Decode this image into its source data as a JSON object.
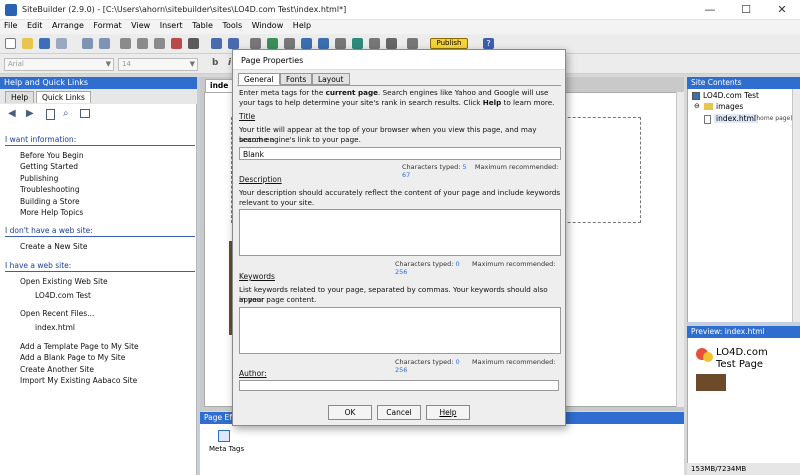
{
  "window": {
    "title": "SiteBuilder (2.9.0) - [C:\\Users\\ahorn\\sitebuilder\\sites\\LO4D.com Test\\index.html*]",
    "minimize": "—",
    "maximize": "☐",
    "close": "✕"
  },
  "menu": [
    "File",
    "Edit",
    "Arrange",
    "Format",
    "View",
    "Insert",
    "Table",
    "Tools",
    "Window",
    "Help"
  ],
  "toolbar": {
    "publish_label": "Publish",
    "help_label": "?"
  },
  "fontbar": {
    "font": "Arial",
    "size": "14",
    "bold": "b",
    "italic": "i"
  },
  "left_panel": {
    "header": "Help and Quick Links",
    "tabs": [
      "Help",
      "Quick Links"
    ],
    "active_tab": "Quick Links",
    "sections": [
      {
        "title": "I want information:",
        "links": [
          "Before You Begin",
          "Getting Started",
          "Publishing",
          "Troubleshooting",
          "Building a Store",
          "More Help Topics"
        ]
      },
      {
        "title": "I don't have a web site:",
        "links": [
          "Create a New Site"
        ]
      },
      {
        "title": "I have a web site:",
        "links": [
          "Open Existing Web Site",
          "LO4D.com Test",
          "Open Recent Files...",
          "index.html",
          "Add a Template Page to My Site",
          "Add a Blank Page to My Site",
          "Create Another Site",
          "Import My Existing Aabaco Site"
        ]
      }
    ]
  },
  "editor": {
    "tab": "inde",
    "page_effects": "Page Effe",
    "meta_tags": "Meta Tags"
  },
  "site_contents": {
    "header": "Site Contents",
    "root": "LO4D.com Test",
    "folder": "images",
    "file": "index.html",
    "file_note": "(home page)"
  },
  "preview": {
    "header": "Preview: index.html",
    "title_line1": "LO4D.com",
    "title_line2": "Test Page"
  },
  "status": {
    "memory": "153MB/7234MB"
  },
  "dialog": {
    "title": "Page Properties",
    "tabs": [
      "General",
      "Fonts",
      "Layout"
    ],
    "active_tab": "General",
    "intro_pre": "Enter meta tags for the ",
    "intro_bold": "current page",
    "intro_post": ". Search engines like Yahoo and Google will use",
    "intro_line2_pre": "your tags to help determine your site's rank in search results. Click ",
    "intro_line2_bold": "Help",
    "intro_line2_post": " to learn more.",
    "title_label": "Title",
    "title_help1": "Your title will appear at the top of your browser when you view this page, and may become a",
    "title_help2": "search engine's link to your page.",
    "title_value": "Blank",
    "title_chars_label": "Characters typed:",
    "title_chars": "5",
    "title_max_label": "Maximum recommended:",
    "title_max": "67",
    "desc_label": "Description",
    "desc_help1": "Your description should accurately reflect the content of your page and include keywords",
    "desc_help2": "relevant to your site.",
    "desc_value": "",
    "desc_chars_label": "Characters typed:",
    "desc_chars": "0",
    "desc_max_label": "Maximum recommended:",
    "desc_max": "256",
    "kw_label": "Keywords",
    "kw_help1": "List keywords related to your page, separated by commas. Your keywords should also appear",
    "kw_help2": "in your page content.",
    "kw_value": "",
    "kw_chars_label": "Characters typed:",
    "kw_chars": "0",
    "kw_max_label": "Maximum recommended:",
    "kw_max": "256",
    "author_label": "Author:",
    "author_value": "",
    "ok": "OK",
    "cancel": "Cancel",
    "help": "Help"
  },
  "colors": {
    "panel_header": "#2f6ecf",
    "link": "#1e3f9a",
    "counter_value": "#2f6ecf",
    "publish": "#f5d33a"
  }
}
